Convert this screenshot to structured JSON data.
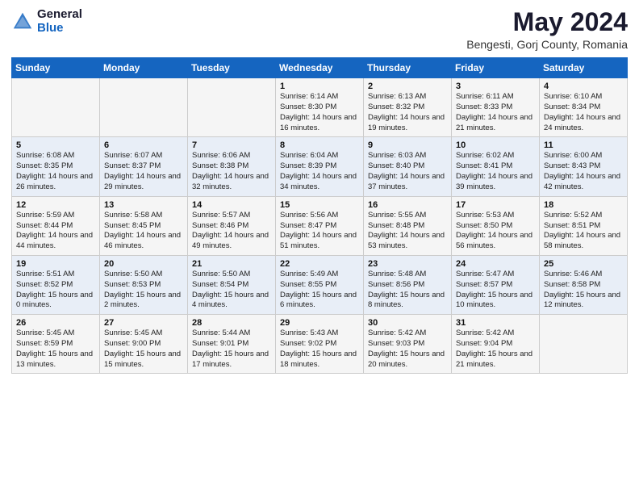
{
  "header": {
    "logo_general": "General",
    "logo_blue": "Blue",
    "main_title": "May 2024",
    "subtitle": "Bengesti, Gorj County, Romania"
  },
  "weekdays": [
    "Sunday",
    "Monday",
    "Tuesday",
    "Wednesday",
    "Thursday",
    "Friday",
    "Saturday"
  ],
  "weeks": [
    [
      {
        "day": "",
        "sunrise": "",
        "sunset": "",
        "daylight": ""
      },
      {
        "day": "",
        "sunrise": "",
        "sunset": "",
        "daylight": ""
      },
      {
        "day": "",
        "sunrise": "",
        "sunset": "",
        "daylight": ""
      },
      {
        "day": "1",
        "sunrise": "Sunrise: 6:14 AM",
        "sunset": "Sunset: 8:30 PM",
        "daylight": "Daylight: 14 hours and 16 minutes."
      },
      {
        "day": "2",
        "sunrise": "Sunrise: 6:13 AM",
        "sunset": "Sunset: 8:32 PM",
        "daylight": "Daylight: 14 hours and 19 minutes."
      },
      {
        "day": "3",
        "sunrise": "Sunrise: 6:11 AM",
        "sunset": "Sunset: 8:33 PM",
        "daylight": "Daylight: 14 hours and 21 minutes."
      },
      {
        "day": "4",
        "sunrise": "Sunrise: 6:10 AM",
        "sunset": "Sunset: 8:34 PM",
        "daylight": "Daylight: 14 hours and 24 minutes."
      }
    ],
    [
      {
        "day": "5",
        "sunrise": "Sunrise: 6:08 AM",
        "sunset": "Sunset: 8:35 PM",
        "daylight": "Daylight: 14 hours and 26 minutes."
      },
      {
        "day": "6",
        "sunrise": "Sunrise: 6:07 AM",
        "sunset": "Sunset: 8:37 PM",
        "daylight": "Daylight: 14 hours and 29 minutes."
      },
      {
        "day": "7",
        "sunrise": "Sunrise: 6:06 AM",
        "sunset": "Sunset: 8:38 PM",
        "daylight": "Daylight: 14 hours and 32 minutes."
      },
      {
        "day": "8",
        "sunrise": "Sunrise: 6:04 AM",
        "sunset": "Sunset: 8:39 PM",
        "daylight": "Daylight: 14 hours and 34 minutes."
      },
      {
        "day": "9",
        "sunrise": "Sunrise: 6:03 AM",
        "sunset": "Sunset: 8:40 PM",
        "daylight": "Daylight: 14 hours and 37 minutes."
      },
      {
        "day": "10",
        "sunrise": "Sunrise: 6:02 AM",
        "sunset": "Sunset: 8:41 PM",
        "daylight": "Daylight: 14 hours and 39 minutes."
      },
      {
        "day": "11",
        "sunrise": "Sunrise: 6:00 AM",
        "sunset": "Sunset: 8:43 PM",
        "daylight": "Daylight: 14 hours and 42 minutes."
      }
    ],
    [
      {
        "day": "12",
        "sunrise": "Sunrise: 5:59 AM",
        "sunset": "Sunset: 8:44 PM",
        "daylight": "Daylight: 14 hours and 44 minutes."
      },
      {
        "day": "13",
        "sunrise": "Sunrise: 5:58 AM",
        "sunset": "Sunset: 8:45 PM",
        "daylight": "Daylight: 14 hours and 46 minutes."
      },
      {
        "day": "14",
        "sunrise": "Sunrise: 5:57 AM",
        "sunset": "Sunset: 8:46 PM",
        "daylight": "Daylight: 14 hours and 49 minutes."
      },
      {
        "day": "15",
        "sunrise": "Sunrise: 5:56 AM",
        "sunset": "Sunset: 8:47 PM",
        "daylight": "Daylight: 14 hours and 51 minutes."
      },
      {
        "day": "16",
        "sunrise": "Sunrise: 5:55 AM",
        "sunset": "Sunset: 8:48 PM",
        "daylight": "Daylight: 14 hours and 53 minutes."
      },
      {
        "day": "17",
        "sunrise": "Sunrise: 5:53 AM",
        "sunset": "Sunset: 8:50 PM",
        "daylight": "Daylight: 14 hours and 56 minutes."
      },
      {
        "day": "18",
        "sunrise": "Sunrise: 5:52 AM",
        "sunset": "Sunset: 8:51 PM",
        "daylight": "Daylight: 14 hours and 58 minutes."
      }
    ],
    [
      {
        "day": "19",
        "sunrise": "Sunrise: 5:51 AM",
        "sunset": "Sunset: 8:52 PM",
        "daylight": "Daylight: 15 hours and 0 minutes."
      },
      {
        "day": "20",
        "sunrise": "Sunrise: 5:50 AM",
        "sunset": "Sunset: 8:53 PM",
        "daylight": "Daylight: 15 hours and 2 minutes."
      },
      {
        "day": "21",
        "sunrise": "Sunrise: 5:50 AM",
        "sunset": "Sunset: 8:54 PM",
        "daylight": "Daylight: 15 hours and 4 minutes."
      },
      {
        "day": "22",
        "sunrise": "Sunrise: 5:49 AM",
        "sunset": "Sunset: 8:55 PM",
        "daylight": "Daylight: 15 hours and 6 minutes."
      },
      {
        "day": "23",
        "sunrise": "Sunrise: 5:48 AM",
        "sunset": "Sunset: 8:56 PM",
        "daylight": "Daylight: 15 hours and 8 minutes."
      },
      {
        "day": "24",
        "sunrise": "Sunrise: 5:47 AM",
        "sunset": "Sunset: 8:57 PM",
        "daylight": "Daylight: 15 hours and 10 minutes."
      },
      {
        "day": "25",
        "sunrise": "Sunrise: 5:46 AM",
        "sunset": "Sunset: 8:58 PM",
        "daylight": "Daylight: 15 hours and 12 minutes."
      }
    ],
    [
      {
        "day": "26",
        "sunrise": "Sunrise: 5:45 AM",
        "sunset": "Sunset: 8:59 PM",
        "daylight": "Daylight: 15 hours and 13 minutes."
      },
      {
        "day": "27",
        "sunrise": "Sunrise: 5:45 AM",
        "sunset": "Sunset: 9:00 PM",
        "daylight": "Daylight: 15 hours and 15 minutes."
      },
      {
        "day": "28",
        "sunrise": "Sunrise: 5:44 AM",
        "sunset": "Sunset: 9:01 PM",
        "daylight": "Daylight: 15 hours and 17 minutes."
      },
      {
        "day": "29",
        "sunrise": "Sunrise: 5:43 AM",
        "sunset": "Sunset: 9:02 PM",
        "daylight": "Daylight: 15 hours and 18 minutes."
      },
      {
        "day": "30",
        "sunrise": "Sunrise: 5:42 AM",
        "sunset": "Sunset: 9:03 PM",
        "daylight": "Daylight: 15 hours and 20 minutes."
      },
      {
        "day": "31",
        "sunrise": "Sunrise: 5:42 AM",
        "sunset": "Sunset: 9:04 PM",
        "daylight": "Daylight: 15 hours and 21 minutes."
      },
      {
        "day": "",
        "sunrise": "",
        "sunset": "",
        "daylight": ""
      }
    ]
  ]
}
